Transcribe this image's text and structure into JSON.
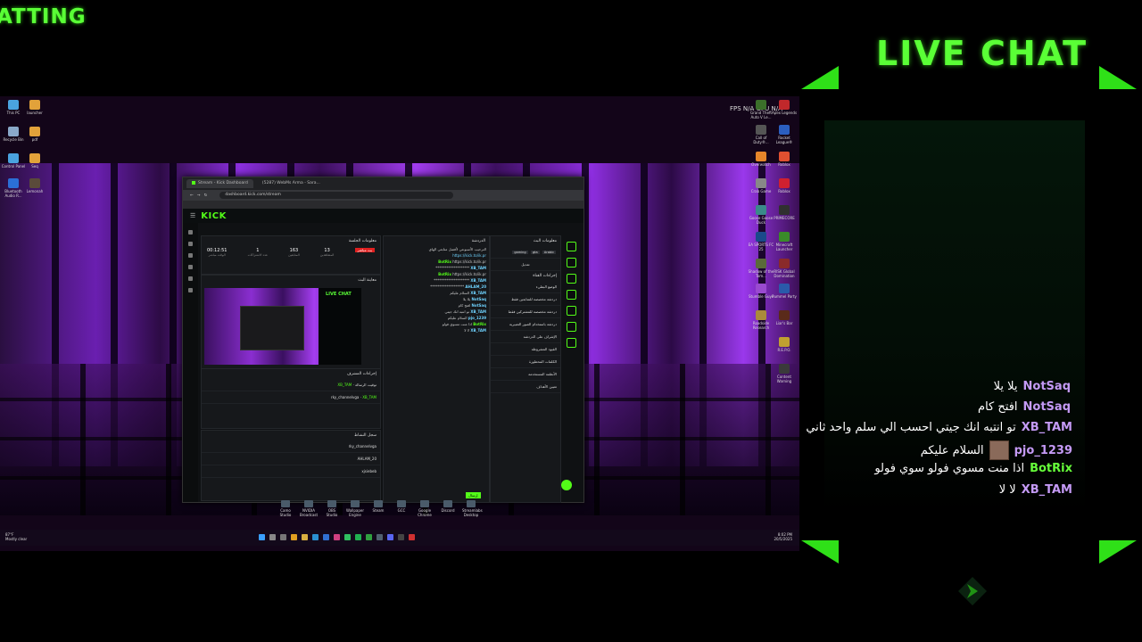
{
  "overlay": {
    "chatting_label": "ATTING",
    "livechat_title": "LIVE CHAT"
  },
  "desktop_icons_left": [
    {
      "label": "This PC",
      "color": "#4aa3df"
    },
    {
      "label": "launcher",
      "color": "#e2a23a"
    },
    {
      "label": "Recycle Bin",
      "color": "#8aa9c9"
    },
    {
      "label": "pdf",
      "color": "#e2a23a"
    },
    {
      "label": "Control Panel",
      "color": "#4aa3df"
    },
    {
      "label": "Seq",
      "color": "#e2a23a"
    },
    {
      "label": "Bluetooth Audio R...",
      "color": "#2b6fd6"
    },
    {
      "label": "Lemonah",
      "color": "#5a4a3a"
    }
  ],
  "desktop_icons_right": [
    {
      "label": "Grand Theft Auto V Le..."
    },
    {
      "label": "Apex Legends"
    },
    {
      "label": "Call of Duty®..."
    },
    {
      "label": "Rocket League®"
    },
    {
      "label": "Overwatch"
    },
    {
      "label": "Roblox"
    },
    {
      "label": "Crab Game"
    },
    {
      "label": "Roblox"
    },
    {
      "label": "Goose Goose Duck"
    },
    {
      "label": "PRIMECORE"
    },
    {
      "label": "EA SPORTS FC 25"
    },
    {
      "label": "Minecraft Launcher"
    },
    {
      "label": "Shadow of the Tom..."
    },
    {
      "label": "RISK Global Domination"
    },
    {
      "label": "Stumble Guys"
    },
    {
      "label": "Pummel Party"
    },
    {
      "label": "Roadside Research"
    },
    {
      "label": "Liar's Bar"
    },
    {
      "label": "R.E.P.O."
    },
    {
      "label": "Content Warning"
    }
  ],
  "fps_readout": "FPS  N/A    GPU  N/A",
  "browser": {
    "tab_active": "Stream - Kick Dashboard",
    "tab_second": "(5287) WebMs Arma - Sara...",
    "url": "dashboard.kick.com/stream",
    "kick_logo": "KICK"
  },
  "dashboard": {
    "session_header": "معلومات الجلسة",
    "live_badge": "بث مباشر",
    "stats": [
      {
        "value": "00:12:51",
        "label": "الوقت مباشر"
      },
      {
        "value": "1",
        "label": "عدد الاشتراكات"
      },
      {
        "value": "163",
        "label": "المتابعين"
      },
      {
        "value": "13",
        "label": "المشاهدين"
      }
    ],
    "preview_header": "معاينة البث",
    "preview_livechat": "LIVE CHAT",
    "actions_header": "إجراءات المشرف",
    "actions": [
      {
        "title": "توقيت الرسالة",
        "user": "XB_TAM"
      },
      {
        "title": "rky_channelvga",
        "user": "XB_TAM"
      }
    ],
    "activity_header": "سجل النشاط",
    "activity": [
      "rky_channelvga",
      "AHLAM_20",
      "xjsiebeb"
    ],
    "chat_header": "الدردشة",
    "chat_pinned": "الترحيب الأسبوعي لأفضل متابعي الهاي",
    "chat_link": "https://kick.to/ik.pr",
    "chat_lines": [
      {
        "user": "BotRix",
        "text": "https://kick.to/ik.pr"
      },
      {
        "user": "XB_TAM",
        "text": "*******************"
      },
      {
        "user": "BotRix",
        "text": "https://kick.to/ik.pr"
      },
      {
        "user": "XB_TAM",
        "text": "********************"
      },
      {
        "user": "AHLAM_20",
        "text": "*******************"
      },
      {
        "user": "XB_TAM",
        "text": "السلام عليكم"
      },
      {
        "user": "NotSaq",
        "text": "يلا يلا"
      },
      {
        "user": "NotSaq",
        "text": "افتح كام"
      },
      {
        "user": "XB_TAM",
        "text": "تو انتبه انك جيتي"
      },
      {
        "user": "pjo_1239",
        "text": "السلام عليكم"
      },
      {
        "user": "BotRix",
        "text": "اذا منت مسوي فولو"
      },
      {
        "user": "XB_TAM",
        "text": "لا لا"
      }
    ],
    "chat_send": "إرسال",
    "stream_info_header": "معلومات البث",
    "stream_tags": [
      "Arabic",
      "gta",
      "gaming"
    ],
    "edit_button": "تعديل",
    "quick_actions_header": "إجراءات القناة",
    "quick_actions": [
      "الوضع البطيء",
      "دردشة مخصصة للمتابعين فقط",
      "دردشة مخصصة للمشتركين فقط",
      "دردشة باستخدام الصور التعبيرية",
      "الإشراف على الدردشة",
      "القيود المشروطة",
      "الكلمات المحظورة",
      "الأنظمة المستخدمة",
      "تعيين الأهداف"
    ]
  },
  "taskbar_apps": [
    "Camo Studio",
    "NVIDIA Broadcast",
    "OBS Studio",
    "Wallpaper Engine",
    "Steam",
    "GCC",
    "Google Chrome",
    "Discord",
    "Streamlabs Desktop"
  ],
  "taskbar": {
    "weather_temp": "87°F",
    "weather_desc": "Mostly clear",
    "time": "8:02 PM",
    "date": "20/5/2025"
  },
  "livechat_messages": [
    {
      "user": "NotSaq",
      "text": "يلا يلا",
      "color": "#c49af5",
      "avatar": false
    },
    {
      "user": "NotSaq",
      "text": "افتح كام",
      "color": "#c49af5",
      "avatar": false
    },
    {
      "user": "XB_TAM",
      "text": "تو انتبه انك جيتي احسب الي سلم واحد ثاني",
      "color": "#c49af5",
      "avatar": false
    },
    {
      "user": "pjo_1239",
      "text": "السلام عليكم",
      "color": "#c49af5",
      "avatar": true
    },
    {
      "user": "BotRix",
      "text": "اذا منت مسوي فولو سوي فولو",
      "color": "#66ff3a",
      "avatar": false
    },
    {
      "user": "XB_TAM",
      "text": "لا لا",
      "color": "#c49af5",
      "avatar": false
    }
  ],
  "colors": {
    "kick_green": "#53fc18",
    "overlay_green": "#5aff36",
    "username_purple": "#c49af5"
  }
}
